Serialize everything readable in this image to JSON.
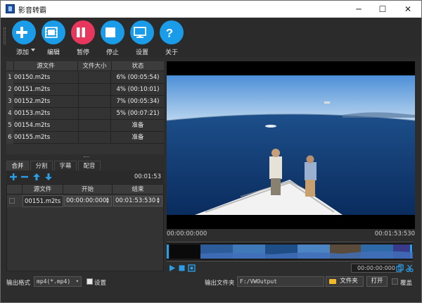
{
  "window": {
    "title": "影音转霸",
    "controls": [
      "─",
      "☐",
      "✕"
    ]
  },
  "toolbar": {
    "buttons": [
      {
        "label": "添加",
        "icon": "plus-icon"
      },
      {
        "label": "编辑",
        "icon": "film-edit-icon"
      },
      {
        "label": "暂停",
        "icon": "pause-icon"
      },
      {
        "label": "停止",
        "icon": "stop-icon"
      },
      {
        "label": "设置",
        "icon": "monitor-settings-icon"
      },
      {
        "label": "关于",
        "icon": "question-icon"
      }
    ]
  },
  "file_table": {
    "headers": [
      "源文件",
      "文件大小",
      "状态"
    ],
    "rows": [
      {
        "num": "1",
        "file": "00150.m2ts",
        "size": "",
        "status": "6% (00:05:54)"
      },
      {
        "num": "2",
        "file": "00151.m2ts",
        "size": "",
        "status": "4% (00:10:01)"
      },
      {
        "num": "3",
        "file": "00152.m2ts",
        "size": "",
        "status": "7% (00:05:34)"
      },
      {
        "num": "4",
        "file": "00153.m2ts",
        "size": "",
        "status": "5% (00:07:21)"
      },
      {
        "num": "5",
        "file": "00154.m2ts",
        "size": "",
        "status": "准备"
      },
      {
        "num": "6",
        "file": "00155.m2ts",
        "size": "",
        "status": "准备"
      }
    ]
  },
  "tabs": [
    "合并",
    "分割",
    "字幕",
    "配音"
  ],
  "segment_tools": {
    "duration": "00:01:53"
  },
  "segment_table": {
    "headers": [
      "源文件",
      "开始",
      "结束"
    ],
    "rows": [
      {
        "file": "00151.m2ts",
        "start": "00:00:00:000",
        "end": "00:01:53:530"
      }
    ]
  },
  "player": {
    "start_time": "00:00:00:000",
    "end_time": "00:01:53:530",
    "current_time": "00:00:00:000"
  },
  "bottom": {
    "format_label": "输出格式",
    "format_value": "mp4(*.mp4)",
    "settings_label": "设置",
    "output_folder_label": "输出文件夹",
    "output_folder_value": "F:/VWOutput",
    "folder_button": "文件夹",
    "open_button": "打开",
    "overwrite_label": "覆盖"
  },
  "colors": {
    "accent_blue": "#1a9ce8",
    "pause_red": "#e8375c",
    "background": "#2d2d2d"
  }
}
